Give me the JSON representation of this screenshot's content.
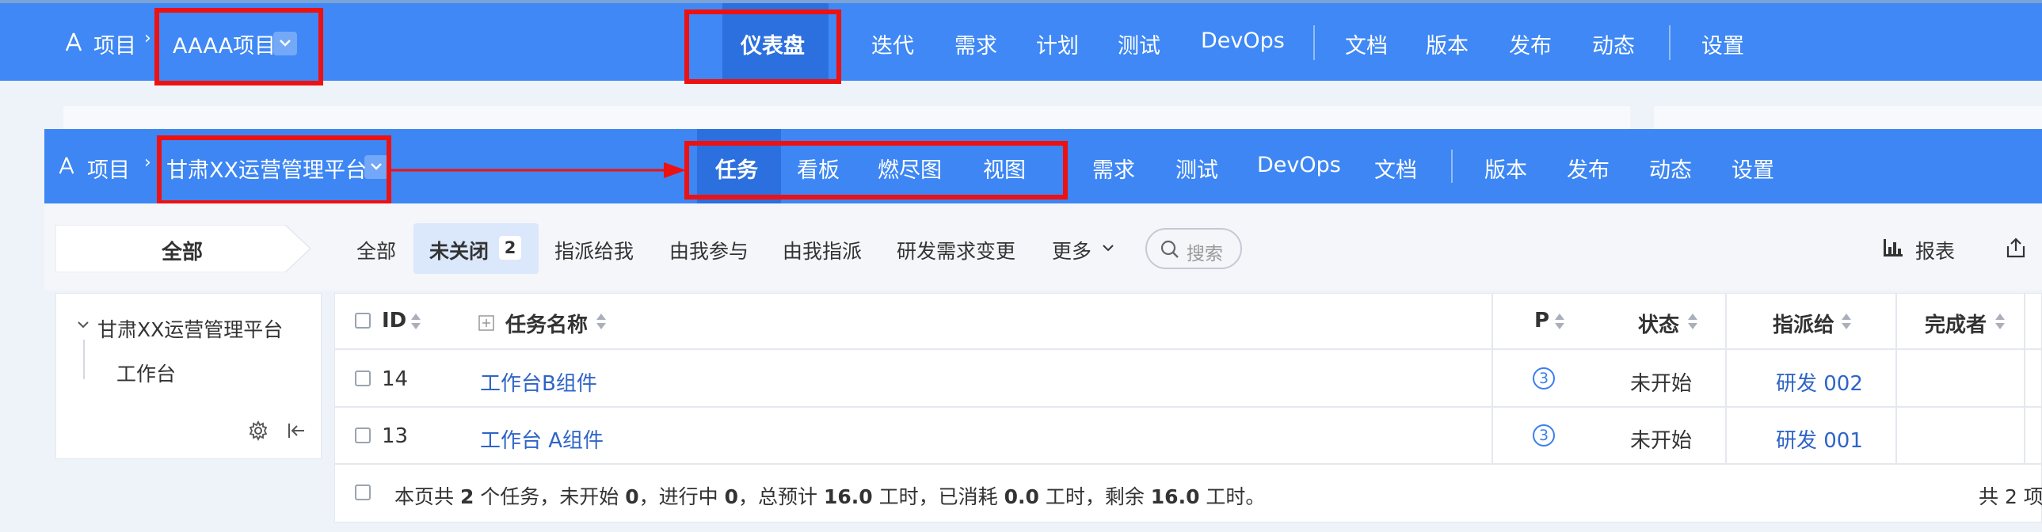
{
  "top_nav": {
    "project_label": "项目",
    "project_name": "AAAA项目",
    "items": [
      "仪表盘",
      "迭代",
      "需求",
      "计划",
      "测试",
      "DevOps",
      "文档",
      "版本",
      "发布",
      "动态",
      "设置"
    ],
    "active": "仪表盘"
  },
  "sub_nav": {
    "project_label": "项目",
    "project_name": "甘肃XX运营管理平台",
    "items": [
      "任务",
      "看板",
      "燃尽图",
      "视图",
      "需求",
      "测试",
      "DevOps",
      "文档",
      "版本",
      "发布",
      "动态",
      "设置"
    ],
    "active": "任务"
  },
  "sidebar": {
    "all_label": "全部",
    "tree_root": "甘肃XX运营管理平台",
    "tree_child": "工作台"
  },
  "filters": {
    "items": [
      "全部",
      "未关闭",
      "指派给我",
      "由我参与",
      "由我指派",
      "研发需求变更",
      "更多"
    ],
    "active": "未关闭",
    "active_count": "2",
    "search_placeholder": "搜索",
    "report_label": "报表"
  },
  "table": {
    "headers": {
      "id": "ID",
      "name": "任务名称",
      "pri": "P",
      "status": "状态",
      "assignee": "指派给",
      "finisher": "完成者"
    },
    "rows": [
      {
        "id": "14",
        "name": "工作台B组件",
        "pri": "3",
        "status": "未开始",
        "assignee": "研发 002"
      },
      {
        "id": "13",
        "name": "工作台 A组件",
        "pri": "3",
        "status": "未开始",
        "assignee": "研发 001"
      }
    ],
    "footer": {
      "p1": "本页共 ",
      "total": "2",
      "p2": " 个任务，未开始 ",
      "not_started": "0",
      "p3": "，进行中 ",
      "in_progress": "0",
      "p4": "，总预计 ",
      "estimate": "16.0",
      "p5": " 工时，已消耗 ",
      "consumed": "0.0",
      "p6": " 工时，剩余 ",
      "left": "16.0",
      "p7": " 工时。",
      "count": "共 2 项"
    }
  },
  "colors": {
    "accent": "#3f88f5",
    "highlight_box": "#ee1111",
    "link": "#2f64c7"
  }
}
